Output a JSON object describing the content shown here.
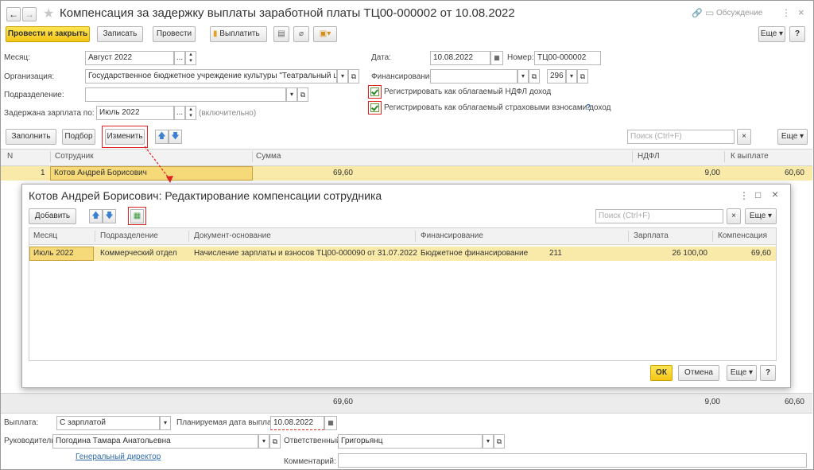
{
  "title": "Компенсация за задержку выплаты заработной платы ТЦ00-000002 от 10.08.2022",
  "header": {
    "discuss_label": "Обсуждение",
    "close": "×",
    "more": "⋮"
  },
  "toolbar": {
    "post_close": "Провести и закрыть",
    "save": "Записать",
    "post": "Провести",
    "pay": "Выплатить",
    "more": "Еще",
    "help": "?"
  },
  "form": {
    "month_label": "Месяц:",
    "month_value": "Август 2022",
    "org_label": "Организация:",
    "org_value": "Государственное бюджетное учреждение культуры \"Театральный центр\"",
    "dept_label": "Подразделение:",
    "dept_value": "",
    "delayed_label": "Задержана зарплата по:",
    "delayed_value": "Июль 2022",
    "delayed_note": "(включительно)",
    "date_label": "Дата:",
    "date_value": "10.08.2022",
    "number_label": "Номер:",
    "number_value": "ТЦ00-000002",
    "fin_label": "Финансирование:",
    "fin_value": "",
    "fin_code": "296",
    "cb_ndfl": "Регистрировать как облагаемый НДФЛ доход",
    "cb_insurance": "Регистрировать как облагаемый страховыми взносами доход",
    "cb_help": "?"
  },
  "table_toolbar": {
    "fill": "Заполнить",
    "pick": "Подбор",
    "change": "Изменить",
    "search_placeholder": "Поиск (Ctrl+F)",
    "clear": "×",
    "more": "Еще"
  },
  "main_table": {
    "headers": {
      "n": "N",
      "employee": "Сотрудник",
      "sum": "Сумма",
      "ndfl": "НДФЛ",
      "pay": "К выплате"
    },
    "rows": [
      {
        "n": "1",
        "employee": "Котов Андрей Борисович",
        "sum": "69,60",
        "ndfl": "9,00",
        "pay": "60,60"
      }
    ],
    "totals": {
      "sum": "69,60",
      "ndfl": "9,00",
      "pay": "60,60"
    }
  },
  "dialog": {
    "title": "Котов Андрей Борисович: Редактирование компенсации сотрудника",
    "more": "⋮",
    "maximize": "□",
    "close": "×",
    "add": "Добавить",
    "search_placeholder": "Поиск (Ctrl+F)",
    "clear": "×",
    "more_btn": "Еще",
    "headers": {
      "month": "Месяц",
      "dept": "Подразделение",
      "doc": "Документ-основание",
      "fin": "Финансирование",
      "salary": "Зарплата",
      "comp": "Компенсация"
    },
    "rows": [
      {
        "month": "Июль 2022",
        "dept": "Коммерческий отдел",
        "doc": "Начисление зарплаты и взносов ТЦ00-000090 от 31.07.2022",
        "fin": "Бюджетное финансирование",
        "fin_code": "211",
        "salary": "26 100,00",
        "comp": "69,60"
      }
    ],
    "ok": "ОК",
    "cancel": "Отмена",
    "more2": "Еще",
    "help": "?"
  },
  "bottom": {
    "payout_label": "Выплата:",
    "payout_value": "С зарплатой",
    "planned_label": "Планируемая дата выплаты:",
    "planned_value": "10.08.2022",
    "head_label": "Руководитель:",
    "head_value": "Погодина Тамара Анатольевна",
    "head_position": "Генеральный директор",
    "resp_label": "Ответственный:",
    "resp_value": "Григорьянц",
    "comment_label": "Комментарий:",
    "comment_value": ""
  },
  "colors": {
    "accent_yellow": "#f4c518",
    "row_highlight": "#f9eaa9",
    "annotation_red": "#dd2222",
    "link_blue": "#2f6aa6"
  }
}
